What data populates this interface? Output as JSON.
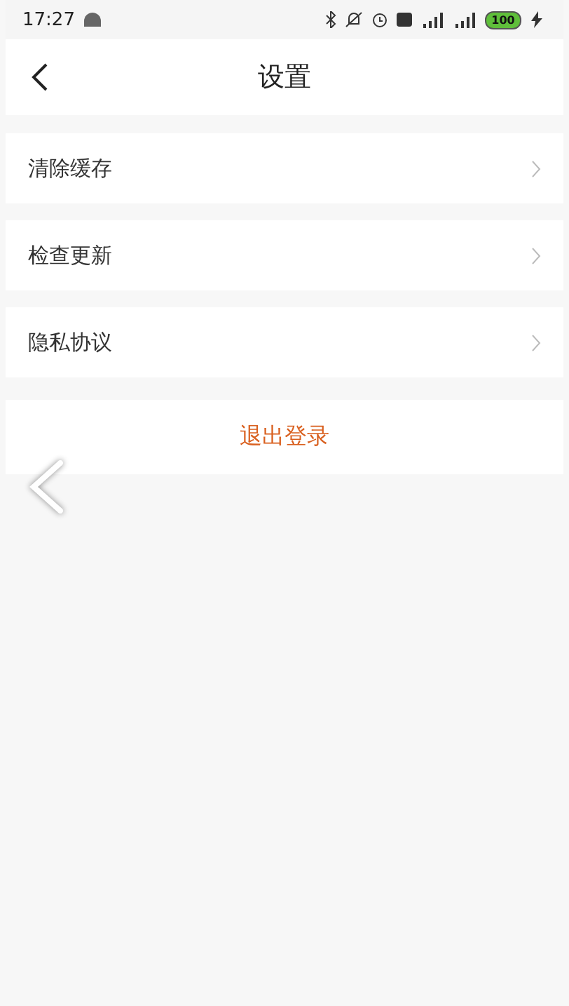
{
  "status_bar": {
    "time": "17:27",
    "battery": "100"
  },
  "header": {
    "title": "设置"
  },
  "menu": [
    {
      "label": "清除缓存"
    },
    {
      "label": "检查更新"
    },
    {
      "label": "隐私协议"
    }
  ],
  "logout_button": "退出登录"
}
